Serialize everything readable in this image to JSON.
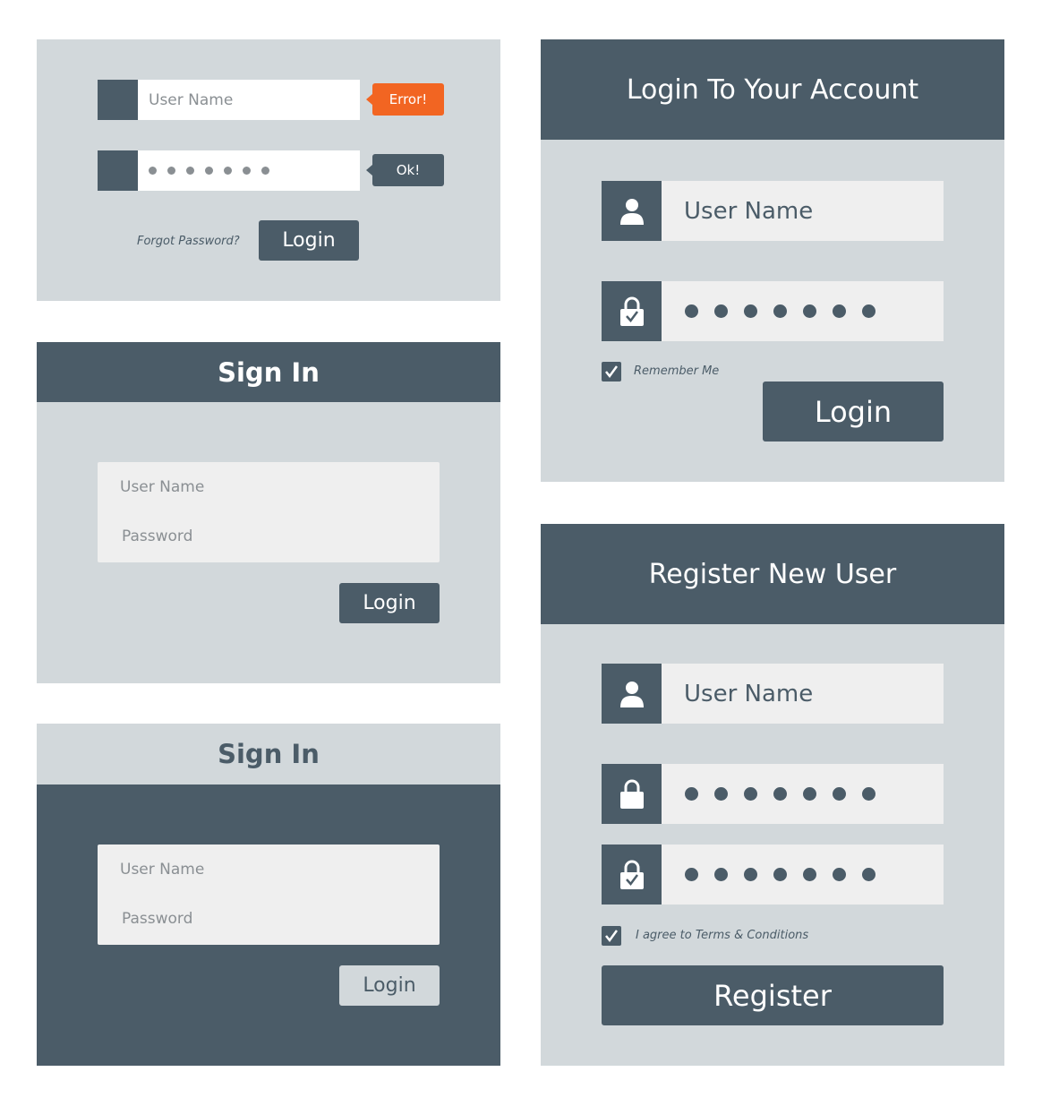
{
  "colors": {
    "panel_light": "#d2d8db",
    "panel_dark": "#4b5c68",
    "field_light": "#efefef",
    "field_white": "#ffffff",
    "error": "#f26522",
    "text_white": "#ffffff",
    "placeholder": "#8a8f93"
  },
  "form1": {
    "username_placeholder": "User Name",
    "error_label": "Error!",
    "ok_label": "Ok!",
    "forgot_password": "Forgot Password?",
    "login_label": "Login"
  },
  "form2": {
    "title": "Sign In",
    "username_placeholder": "User Name",
    "password_placeholder": "Password",
    "login_label": "Login"
  },
  "form3": {
    "title": "Sign In",
    "username_placeholder": "User Name",
    "password_placeholder": "Password",
    "login_label": "Login"
  },
  "form4": {
    "title": "Login To Your Account",
    "username_placeholder": "User Name",
    "remember_me": "Remember Me",
    "login_label": "Login",
    "icons": [
      "user-icon",
      "lock-icon"
    ]
  },
  "form5": {
    "title": "Register New User",
    "username_placeholder": "User Name",
    "terms_label": "I agree to Terms & Conditions",
    "register_label": "Register",
    "icons": [
      "user-icon",
      "lock-icon",
      "lock-check-icon"
    ]
  }
}
